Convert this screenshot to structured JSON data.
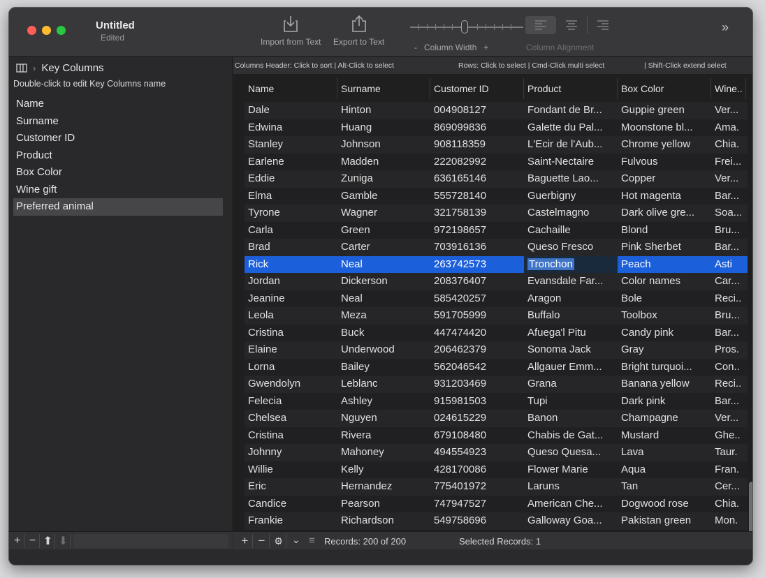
{
  "window": {
    "title": "Untitled",
    "subtitle": "Edited",
    "traffic_lights": [
      "#ff5f57",
      "#febc2e",
      "#28c840"
    ]
  },
  "toolbar": {
    "import_label": "Import from Text",
    "export_label": "Export to Text",
    "width_minus": "-",
    "width_label": "Column Width",
    "width_plus": "+",
    "alignment_label": "Column Alignment",
    "more_glyph": "»"
  },
  "sidebar": {
    "crumb_icon": "sidebar-icon",
    "crumb_sep": "›",
    "crumb_label": "Key Columns",
    "hint": "Double-click to edit Key Columns name",
    "items": [
      "Name",
      "Surname",
      "Customer ID",
      "Product",
      "Box Color",
      "Wine gift",
      "Preferred animal"
    ],
    "selected_index": 6,
    "footer": {
      "add": "+",
      "remove": "−",
      "up": "⬆",
      "down": "⬇"
    }
  },
  "hints": {
    "columns": "Columns Header: Click to sort | Alt-Click to select",
    "rows": "Rows: Click to select | Cmd-Click multi select",
    "shift": "| Shift-Click extend select"
  },
  "table": {
    "headers": [
      "Name",
      "Surname",
      "Customer ID",
      "Product",
      "Box Color",
      "Wine.."
    ],
    "selected_row": 9,
    "edit_col": 3,
    "rows": [
      [
        "Dale",
        "Hinton",
        "004908127",
        "Fondant de Br...",
        "Guppie green",
        "Ver..."
      ],
      [
        "Edwina",
        "Huang",
        "869099836",
        "Galette du Pal...",
        "Moonstone bl...",
        "Ama."
      ],
      [
        "Stanley",
        "Johnson",
        "908118359",
        "L'Ecir de l'Aub...",
        "Chrome yellow",
        "Chia."
      ],
      [
        "Earlene",
        "Madden",
        "222082992",
        "Saint-Nectaire",
        "Fulvous",
        "Frei..."
      ],
      [
        "Eddie",
        "Zuniga",
        "636165146",
        "Baguette Lao...",
        "Copper",
        "Ver..."
      ],
      [
        "Elma",
        "Gamble",
        "555728140",
        "Guerbigny",
        "Hot magenta",
        "Bar..."
      ],
      [
        "Tyrone",
        "Wagner",
        "321758139",
        "Castelmagno",
        "Dark olive gre...",
        "Soa..."
      ],
      [
        "Carla",
        "Green",
        "972198657",
        "Cachaille",
        "Blond",
        "Bru..."
      ],
      [
        "Brad",
        "Carter",
        "703916136",
        "Queso Fresco",
        "Pink Sherbet",
        "Bar..."
      ],
      [
        "Rick",
        "Neal",
        "263742573",
        "Tronchon",
        "Peach",
        "Asti"
      ],
      [
        "Jordan",
        "Dickerson",
        "208376407",
        "Evansdale Far...",
        "Color names",
        "Car..."
      ],
      [
        "Jeanine",
        "Neal",
        "585420257",
        "Aragon",
        "Bole",
        "Reci.."
      ],
      [
        "Leola",
        "Meza",
        "591705999",
        "Buffalo",
        "Toolbox",
        "Bru..."
      ],
      [
        "Cristina",
        "Buck",
        "447474420",
        "Afuega'l Pitu",
        "Candy pink",
        "Bar..."
      ],
      [
        "Elaine",
        "Underwood",
        "206462379",
        "Sonoma Jack",
        "Gray",
        "Pros."
      ],
      [
        "Lorna",
        "Bailey",
        "562046542",
        "Allgauer Emm...",
        "Bright turquoi...",
        "Con.."
      ],
      [
        "Gwendolyn",
        "Leblanc",
        "931203469",
        "Grana",
        "Banana yellow",
        "Reci.."
      ],
      [
        "Felecia",
        "Ashley",
        "915981503",
        "Tupi",
        "Dark pink",
        "Bar..."
      ],
      [
        "Chelsea",
        "Nguyen",
        "024615229",
        "Banon",
        "Champagne",
        "Ver..."
      ],
      [
        "Cristina",
        "Rivera",
        "679108480",
        "Chabis de Gat...",
        "Mustard",
        "Ghe.."
      ],
      [
        "Johnny",
        "Mahoney",
        "494554923",
        "Queso Quesa...",
        "Lava",
        "Taur."
      ],
      [
        "Willie",
        "Kelly",
        "428170086",
        "Flower Marie",
        "Aqua",
        "Fran."
      ],
      [
        "Eric",
        "Hernandez",
        "775401972",
        "Laruns",
        "Tan",
        "Cer..."
      ],
      [
        "Candice",
        "Pearson",
        "747947527",
        "American Che...",
        "Dogwood rose",
        "Chia."
      ],
      [
        "Frankie",
        "Richardson",
        "549758696",
        "Galloway Goa...",
        "Pakistan green",
        "Mon."
      ]
    ]
  },
  "footer": {
    "add": "+",
    "remove": "−",
    "gear": "⚙",
    "gear_chevron": "⌄",
    "list_icon": "≡",
    "records": "Records: 200 of 200",
    "selected": "Selected Records: 1"
  }
}
